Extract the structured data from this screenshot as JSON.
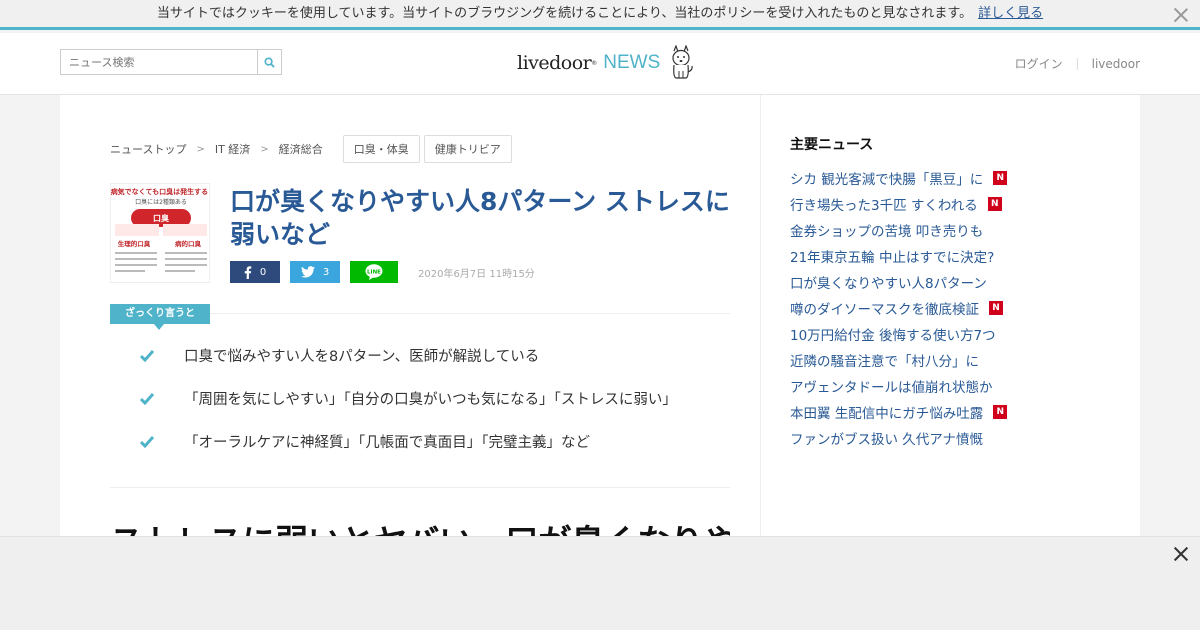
{
  "cookie": {
    "message": "当サイトではクッキーを使用しています。当サイトのブラウジングを続けることにより、当社のポリシーを受け入れたものと見なされます。",
    "link": "詳しく見る"
  },
  "header": {
    "search_placeholder": "ニュース検索",
    "logo_main": "livedoor",
    "logo_news": "NEWS",
    "login": "ログイン",
    "livedoor": "livedoor"
  },
  "breadcrumb": [
    "ニューストップ",
    "IT 経済",
    "経済総合"
  ],
  "tags": [
    "口臭・体臭",
    "健康トリビア"
  ],
  "article": {
    "title": "口が臭くなりやすい人8パターン ストレスに弱いなど",
    "date": "2020年6月7日 11時15分",
    "share_counts": {
      "facebook": "0",
      "twitter": "3"
    },
    "summary_label": "ざっくり言うと",
    "summary": [
      "口臭で悩みやすい人を8パターン、医師が解説している",
      "「周囲を気にしやすい」「自分の口臭がいつも気になる」「ストレスに弱い」",
      "「オーラルケアに神経質」「几帳面で真面目」「完璧主義」など"
    ],
    "heading2": "ストレスに弱いとヤバい　口が臭くなりやすい",
    "thumb": {
      "title": "病気でなくても口臭は発生する!",
      "subtitle": "口臭には2種類ある",
      "center": "口臭",
      "left": "生理的口臭",
      "right": "病的口臭"
    }
  },
  "sidebar": {
    "title": "主要ニュース",
    "items": [
      {
        "text": "シカ 観光客減で快腸「黒豆」に",
        "new": true
      },
      {
        "text": "行き場失った3千匹 すくわれる",
        "new": true
      },
      {
        "text": "金券ショップの苦境 叩き売りも",
        "new": false
      },
      {
        "text": "21年東京五輪 中止はすでに決定?",
        "new": false
      },
      {
        "text": "口が臭くなりやすい人8パターン",
        "new": false
      },
      {
        "text": "噂のダイソーマスクを徹底検証",
        "new": true
      },
      {
        "text": "10万円給付金 後悔する使い方7つ",
        "new": false
      },
      {
        "text": "近隣の騒音注意で「村八分」に",
        "new": false
      },
      {
        "text": "アヴェンタドールは値崩れ状態か",
        "new": false
      },
      {
        "text": "本田翼 生配信中にガチ悩み吐露",
        "new": true
      },
      {
        "text": "ファンがブス扱い 久代アナ憤慨",
        "new": false
      }
    ],
    "badge": "N"
  },
  "colors": {
    "accent": "#4fb3c9",
    "link": "#2a5a96",
    "facebook": "#2e4a7d",
    "twitter": "#3aa6dd",
    "line": "#00b900",
    "badge": "#d0021b"
  }
}
